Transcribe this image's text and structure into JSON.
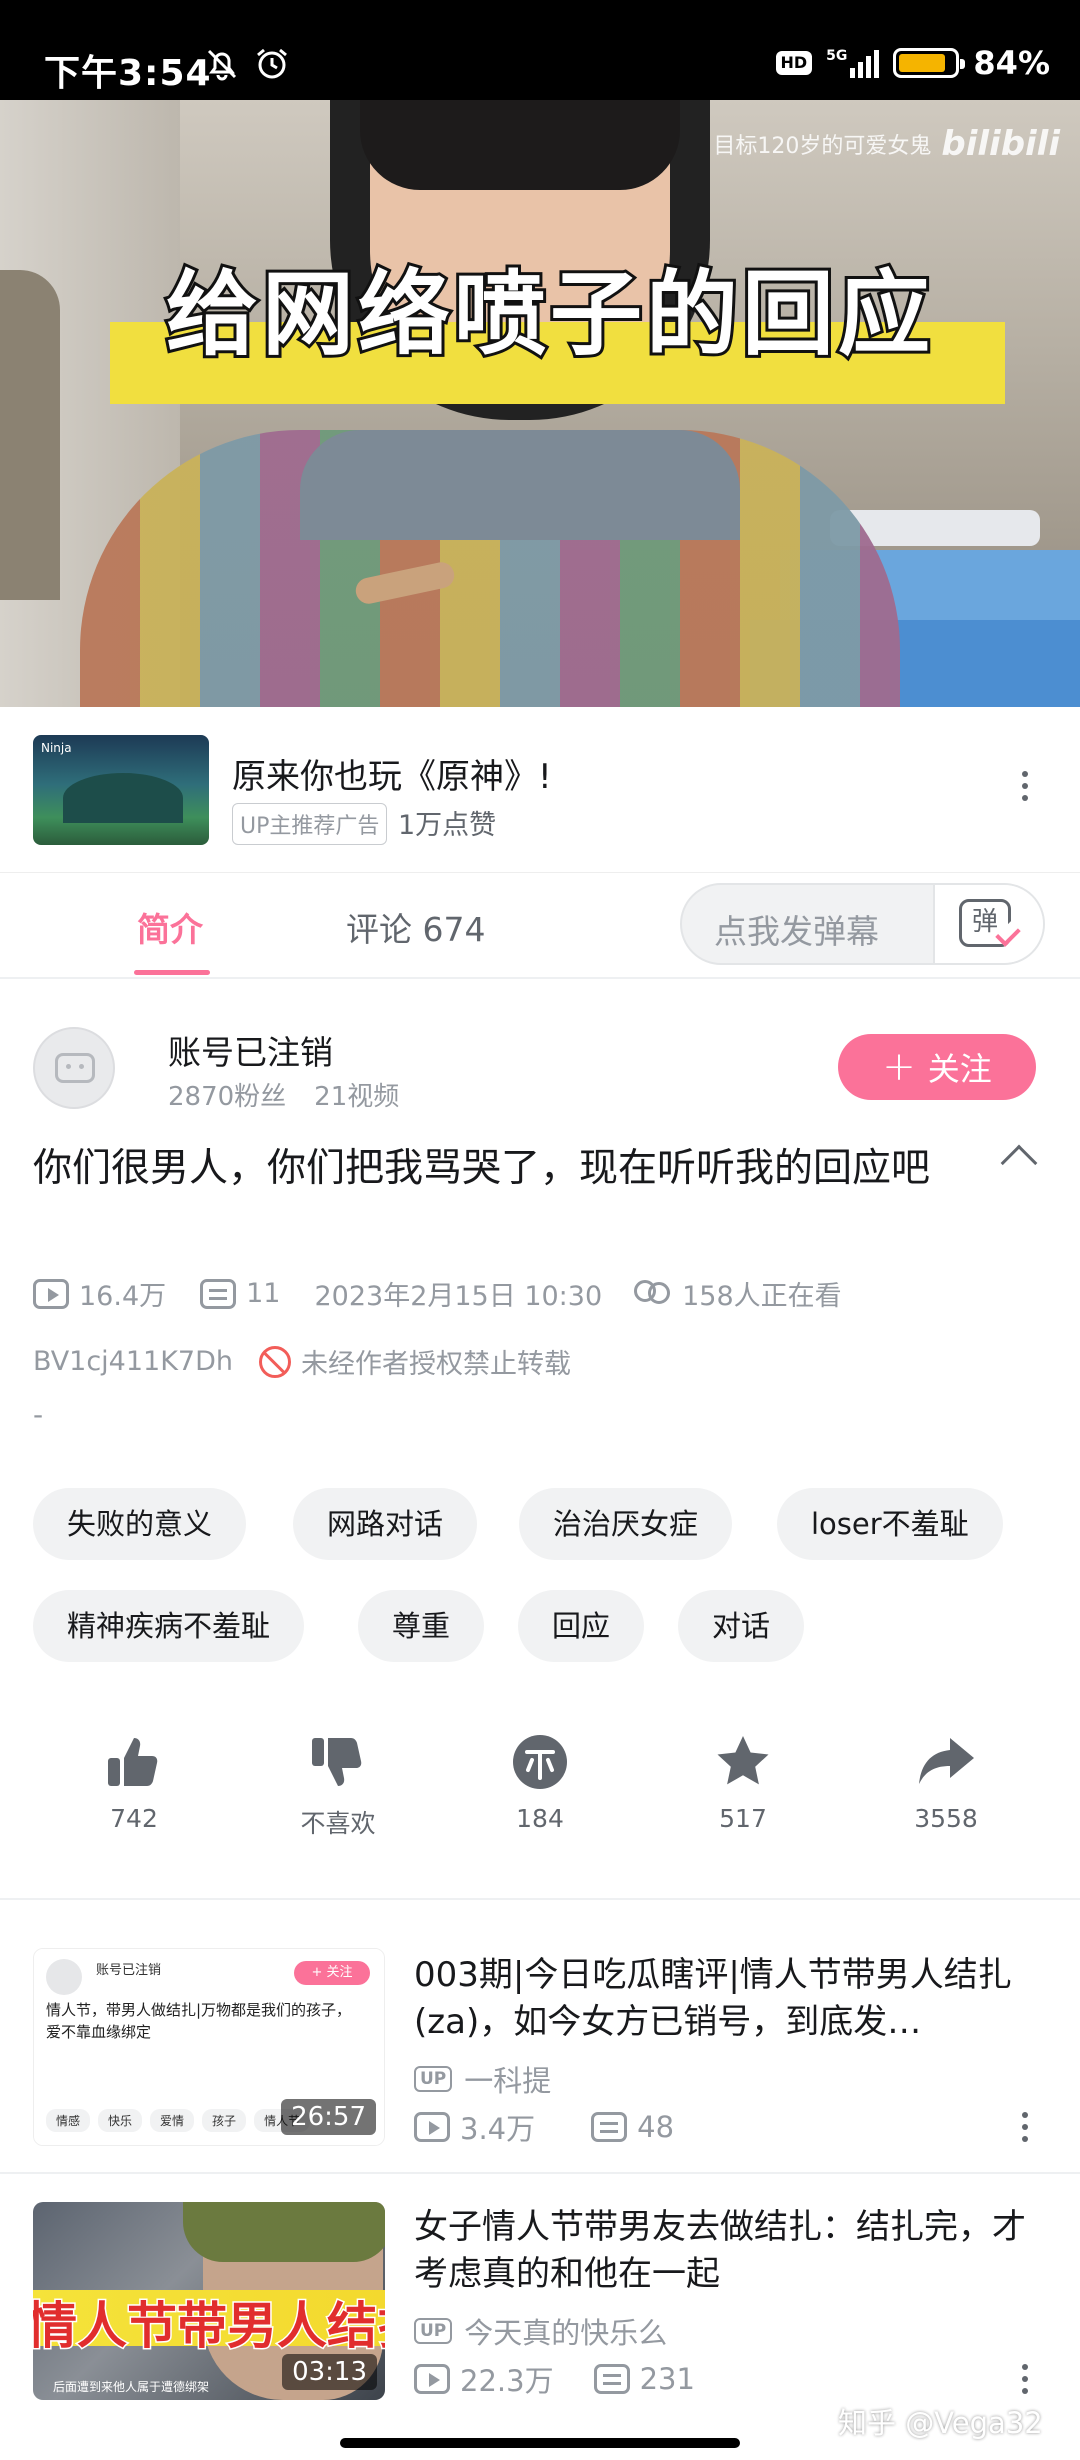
{
  "status_bar": {
    "time": "下午3:54",
    "network": "5G",
    "battery": "84%",
    "battery_level": 0.84,
    "hd": "HD"
  },
  "video": {
    "caption": "给网络喷子的回应",
    "watermark_channel": "目标120岁的可爱女鬼",
    "watermark_logo": "bilibili"
  },
  "ad": {
    "title": "原来你也玩《原神》!",
    "tag": "UP主推荐广告",
    "likes": "1万点赞",
    "thumb_logo": "Ninja"
  },
  "tabs": [
    {
      "label": "简介"
    },
    {
      "label": "评论 674"
    }
  ],
  "danmaku": {
    "placeholder": "点我发弹幕",
    "button": "弹"
  },
  "uploader": {
    "name": "账号已注销",
    "fans": "2870粉丝",
    "videos": "21视频",
    "follow": "关注",
    "follow_plus": "+"
  },
  "video_info": {
    "title": "你们很男人，你们把我骂哭了，现在听听我的回应吧",
    "views": "16.4万",
    "danmaku_count": "11",
    "date": "2023年2月15日 10:30",
    "watching": "158人正在看",
    "bvid": "BV1cj411K7Dh",
    "copyright": "未经作者授权禁止转载",
    "desc": "-"
  },
  "tags": [
    "失败的意义",
    "网路对话",
    "治治厌女症",
    "loser不羞耻",
    "精神疾病不羞耻",
    "尊重",
    "回应",
    "对话"
  ],
  "actions": [
    {
      "icon": "thumbs-up-icon",
      "label": "742"
    },
    {
      "icon": "thumbs-down-icon",
      "label": "不喜欢"
    },
    {
      "icon": "coin-icon",
      "label": "184"
    },
    {
      "icon": "star-icon",
      "label": "517"
    },
    {
      "icon": "share-icon",
      "label": "3558"
    }
  ],
  "related": [
    {
      "title": "003期|今日吃瓜瞎评|情人节带男人结扎(za)，如今女方已销号，到底发…",
      "up": "一科提",
      "views": "3.4万",
      "danmaku": "48",
      "duration": "26:57",
      "thumb": {
        "name": "账号已注销",
        "follow": "+ 关注",
        "title": "情人节，带男人做结扎|万物都是我们的孩子，爱不靠血缘绑定",
        "tags": [
          "情感",
          "快乐",
          "爱情",
          "孩子",
          "情人节"
        ]
      }
    },
    {
      "title": "女子情人节带男友去做结扎：结扎完，才考虑真的和他在一起",
      "up": "今天真的快乐么",
      "views": "22.3万",
      "danmaku": "231",
      "duration": "03:13",
      "thumb": {
        "band": "情人节带男人结扎",
        "sub": "后面遭到来他人属于遭德绑架"
      }
    }
  ],
  "up_badge": "UP",
  "footer_watermark": "知乎 @Vega32",
  "colors": {
    "accent": "#fb7299",
    "text_primary": "#18191c",
    "text_secondary": "#9499a0"
  }
}
